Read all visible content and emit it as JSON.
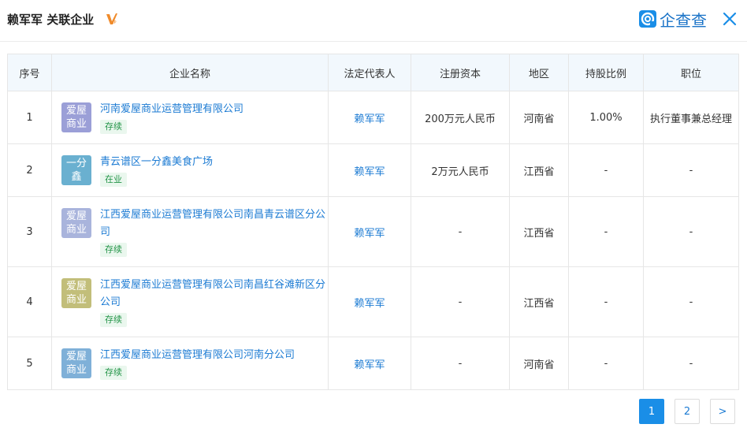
{
  "header": {
    "title": "赖军军 关联企业",
    "logo_text": "企查查",
    "vip_icon": "vip-icon",
    "close_icon": "close-icon"
  },
  "table": {
    "columns": [
      "序号",
      "企业名称",
      "法定代表人",
      "注册资本",
      "地区",
      "持股比例",
      "职位"
    ],
    "rows": [
      {
        "index": "1",
        "avatar": "爱屋\n商业",
        "avatar_color": "#9b9fd7",
        "name": "河南爱屋商业运营管理有限公司",
        "status": "存续",
        "legal_rep": "赖军军",
        "capital": "200万元人民币",
        "region": "河南省",
        "share": "1.00%",
        "position": "执行董事兼总经理"
      },
      {
        "index": "2",
        "avatar": "一分\n鑫",
        "avatar_color": "#6ab0d0",
        "name": "青云谱区一分鑫美食广场",
        "status": "在业",
        "legal_rep": "赖军军",
        "capital": "2万元人民币",
        "region": "江西省",
        "share": "-",
        "position": "-"
      },
      {
        "index": "3",
        "avatar": "爱屋\n商业",
        "avatar_color": "#a9b4dc",
        "name": "江西爱屋商业运营管理有限公司南昌青云谱区分公司",
        "status": "存续",
        "legal_rep": "赖军军",
        "capital": "-",
        "region": "江西省",
        "share": "-",
        "position": "-"
      },
      {
        "index": "4",
        "avatar": "爱屋\n商业",
        "avatar_color": "#c2be7a",
        "name": "江西爱屋商业运营管理有限公司南昌红谷滩新区分公司",
        "status": "存续",
        "legal_rep": "赖军军",
        "capital": "-",
        "region": "江西省",
        "share": "-",
        "position": "-"
      },
      {
        "index": "5",
        "avatar": "爱屋\n商业",
        "avatar_color": "#7fb0d8",
        "name": "江西爱屋商业运营管理有限公司河南分公司",
        "status": "存续",
        "legal_rep": "赖军军",
        "capital": "-",
        "region": "河南省",
        "share": "-",
        "position": "-"
      }
    ]
  },
  "pagination": {
    "pages": [
      "1",
      "2"
    ],
    "current": "1",
    "next": ">"
  },
  "colors": {
    "accent": "#1a8ee7",
    "link": "#1c7bd3",
    "status_bg": "#eaf7ee",
    "status_text": "#229447"
  }
}
